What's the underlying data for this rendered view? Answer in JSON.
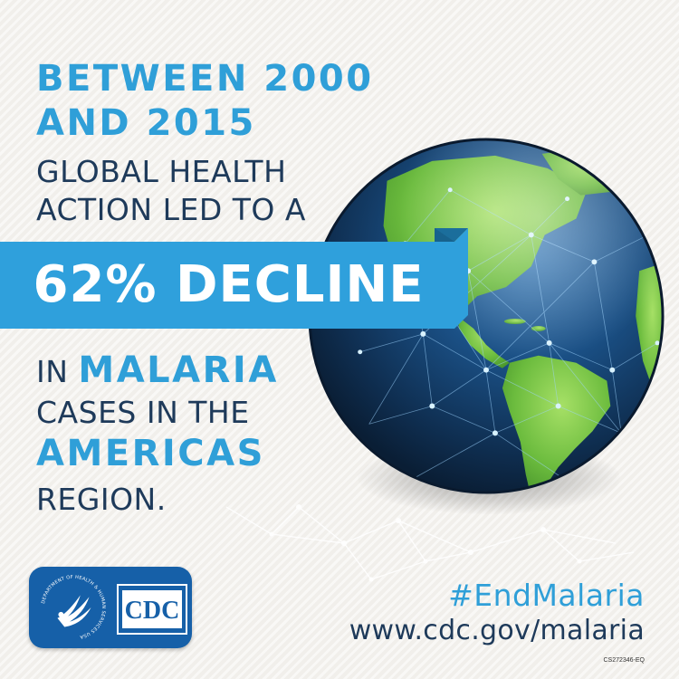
{
  "headline": {
    "line1": "BETWEEN 2000",
    "line2": "AND 2015",
    "line3": "GLOBAL HEALTH",
    "line4": "ACTION LED TO A"
  },
  "ribbon": {
    "text": "62% DECLINE"
  },
  "body": {
    "line1_prefix": "IN ",
    "line1_highlight": "MALARIA",
    "line2": "CASES IN THE",
    "line3": "AMERICAS",
    "line4": "REGION."
  },
  "footer": {
    "hashtag": "#EndMalaria",
    "url": "www.cdc.gov/malaria",
    "code": "CS272346-EQ"
  },
  "logos": {
    "hhs_seal_text": "DEPARTMENT OF HEALTH & HUMAN SERVICES USA",
    "cdc_text": "CDC"
  },
  "colors": {
    "accent_blue": "#2f9fd8",
    "navy_text": "#1e3a5a",
    "ribbon_blue": "#2fa0dc",
    "logo_card_blue": "#1660a8",
    "land_green": "#7ec94a",
    "ocean_blue": "#1a4f84"
  },
  "icons": {
    "globe": "globe-americas-icon",
    "hhs": "hhs-eagle-seal-icon",
    "cdc": "cdc-logo-icon"
  }
}
